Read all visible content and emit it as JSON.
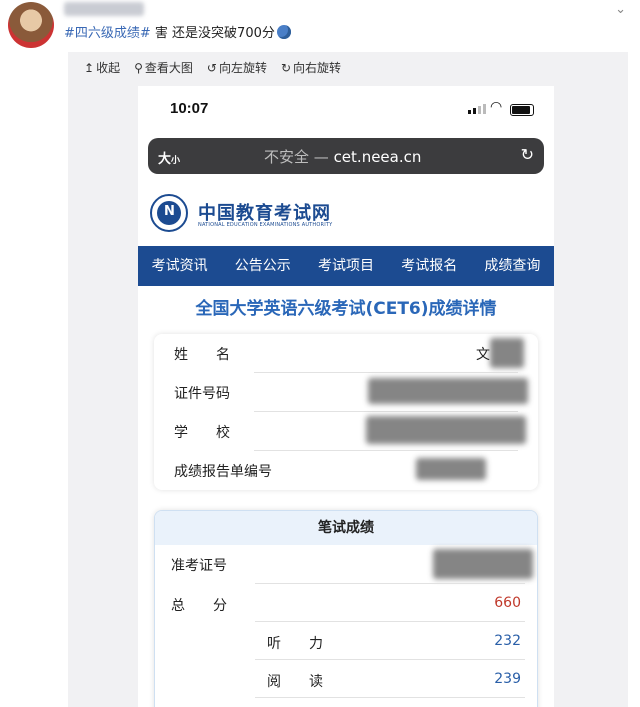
{
  "post": {
    "hashtag": "#四六级成绩#",
    "text": " 害 还是没突破700分"
  },
  "viewer_toolbar": {
    "collapse": "收起",
    "view_large": "查看大图",
    "rotate_left": "向左旋转",
    "rotate_right": "向右旋转"
  },
  "status_bar": {
    "time": "10:07"
  },
  "browser": {
    "text_size": "大",
    "text_size_small": "小",
    "security": "不安全",
    "url": "cet.neea.cn"
  },
  "site": {
    "name": "中国教育考试网",
    "name_en": "NATIONAL EDUCATION EXAMINATIONS AUTHORITY",
    "nav": [
      "考试资讯",
      "公告公示",
      "考试项目",
      "考试报名",
      "成绩查询"
    ],
    "page_title": "全国大学英语六级考试(CET6)成绩详情"
  },
  "info": {
    "name_label": "姓　　名",
    "name_value_visible": "文",
    "id_label": "证件号码",
    "school_label": "学　　校",
    "report_label": "成绩报告单编号"
  },
  "scores": {
    "header": "笔试成绩",
    "admission_label": "准考证号",
    "total_label": "总　　分",
    "total_value": "660",
    "listening_label": "听　　力",
    "listening_value": "232",
    "reading_label": "阅　　读",
    "reading_value": "239"
  },
  "colors": {
    "brand_blue": "#1c4b91",
    "title_blue": "#2a67b8",
    "total_red": "#c0392b",
    "hashtag_blue": "#3a69b5"
  }
}
